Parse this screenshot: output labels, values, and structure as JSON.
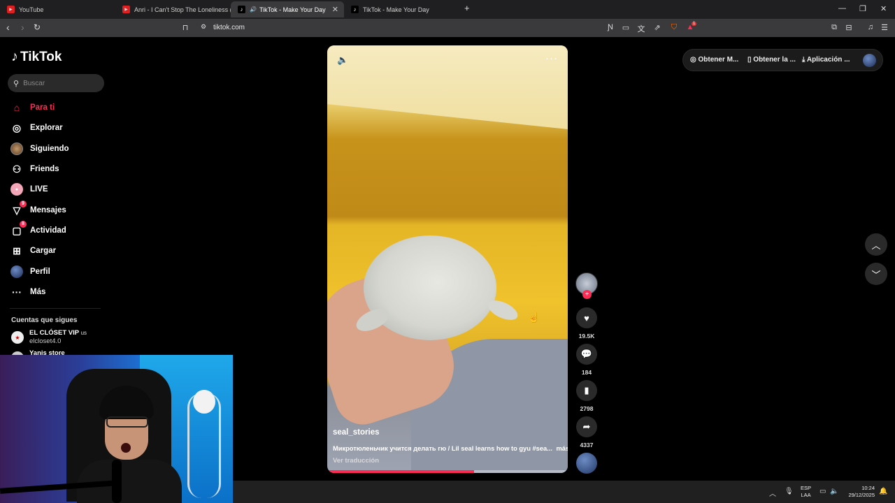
{
  "browser": {
    "tabs": [
      {
        "title": "YouTube",
        "icon": "youtube-icon",
        "active": false
      },
      {
        "title": "Anri - I Can't Stop The Loneliness (Sub",
        "icon": "youtube-icon",
        "active": false
      },
      {
        "title": "TikTok - Make Your Day",
        "icon": "tiktok-icon",
        "active": true
      },
      {
        "title": "TikTok - Make Your Day",
        "icon": "tiktok-icon",
        "active": false
      }
    ],
    "new_tab": "+",
    "url": "tiktok.com",
    "shield_badge": "1"
  },
  "tiktok": {
    "logo_text": "TikTok",
    "search_placeholder": "Buscar",
    "nav": [
      {
        "label": "Para ti",
        "icon": "home-icon",
        "active": true
      },
      {
        "label": "Explorar",
        "icon": "compass-icon"
      },
      {
        "label": "Siguiendo",
        "icon": "following-avatar-icon"
      },
      {
        "label": "Friends",
        "icon": "friends-icon"
      },
      {
        "label": "LIVE",
        "icon": "live-icon"
      },
      {
        "label": "Mensajes",
        "icon": "send-icon",
        "badge": "9"
      },
      {
        "label": "Actividad",
        "icon": "activity-icon",
        "badge": "8"
      },
      {
        "label": "Cargar",
        "icon": "upload-icon"
      },
      {
        "label": "Perfil",
        "icon": "profile-avatar-icon"
      },
      {
        "label": "Más",
        "icon": "more-dots-icon"
      }
    ],
    "following_title": "Cuentas que sigues",
    "following": [
      {
        "name": "EL CLÓSET VIP",
        "flag": "us",
        "handle": "elcloset4.0"
      },
      {
        "name": "Yanis store",
        "handle": ""
      }
    ],
    "top_actions": [
      {
        "label": "Obtener M...",
        "icon": "coin-icon"
      },
      {
        "label": "Obtener la ...",
        "icon": "phone-icon"
      },
      {
        "label": "Aplicación ...",
        "icon": "download-icon"
      }
    ],
    "video": {
      "author": "seal_stories",
      "description": "Микротюленьчик учится делать гю / Lil seal learns how to gyu #sea...",
      "more": "más",
      "translate": "Ver traducción",
      "progress": 0.61,
      "likes": "19.5K",
      "comments": "184",
      "saves": "2798",
      "shares": "4337"
    }
  },
  "taskbar": {
    "lang_top": "ESP",
    "lang_bottom": "LAA",
    "time": "10:24",
    "date": "29/12/2025"
  },
  "colors": {
    "accent": "#fe2c55",
    "background": "#000000",
    "tabbar": "#1f1f21",
    "addressbar": "#3a3a3d"
  }
}
